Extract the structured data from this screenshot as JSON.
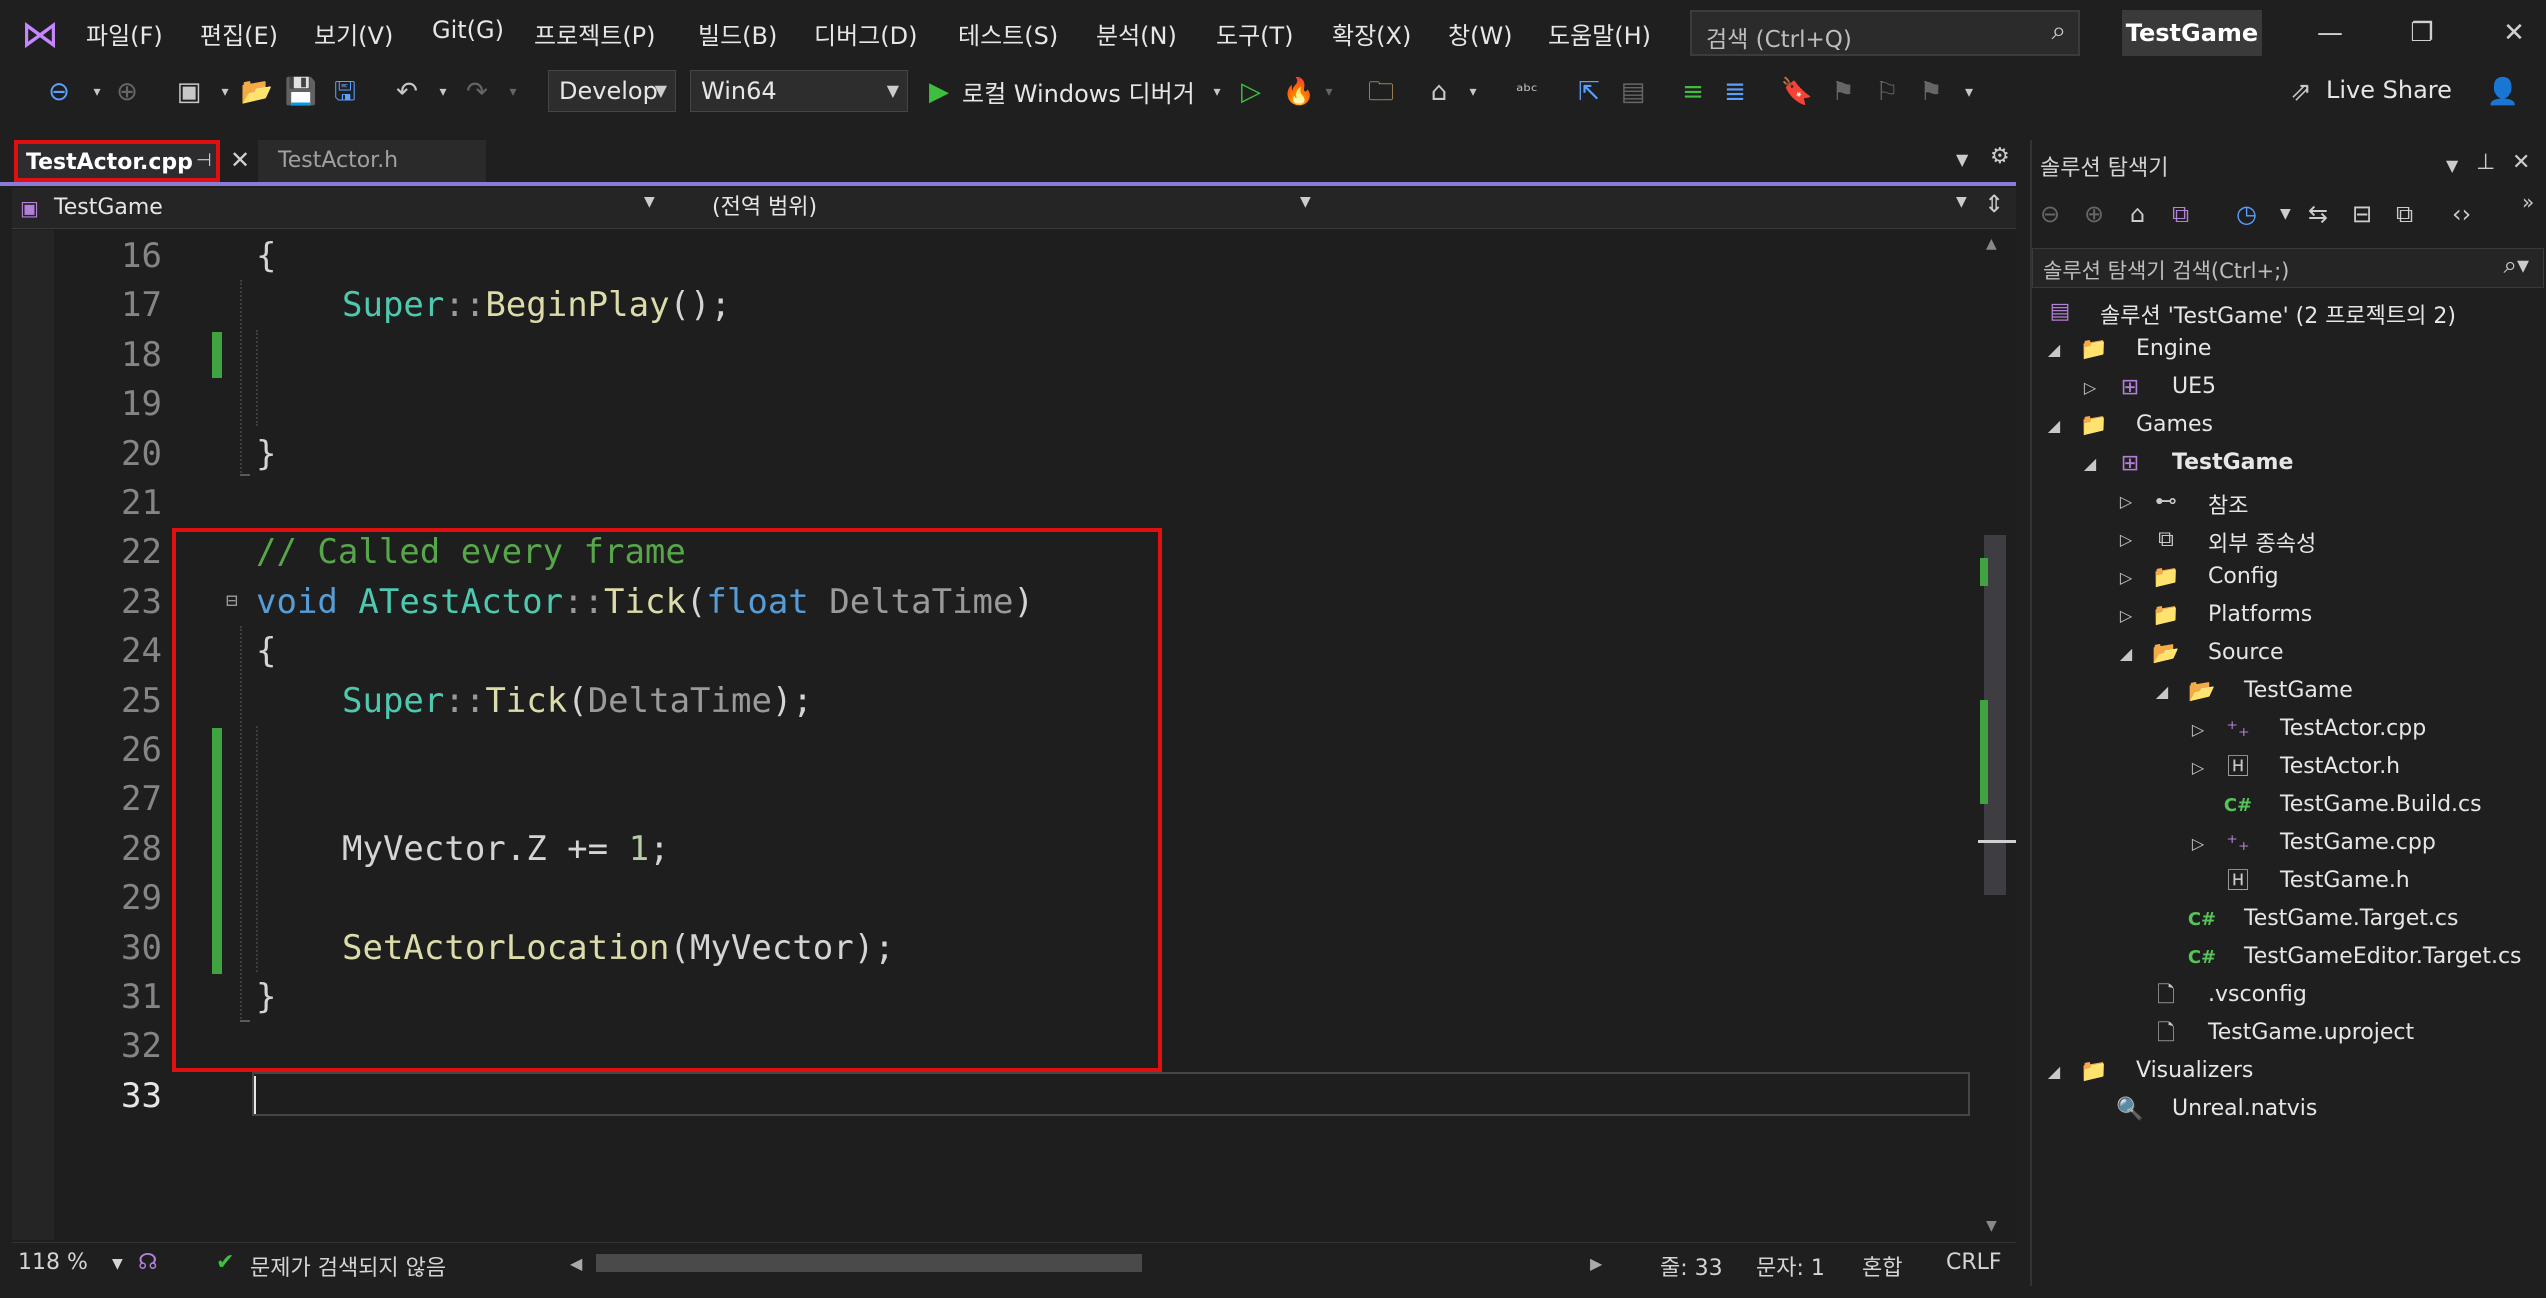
{
  "menu": {
    "items": [
      "파일(F)",
      "편집(E)",
      "보기(V)",
      "Git(G)",
      "프로젝트(P)",
      "빌드(B)",
      "디버그(D)",
      "테스트(S)",
      "분석(N)",
      "도구(T)",
      "확장(X)",
      "창(W)",
      "도움말(H)"
    ],
    "search_placeholder": "검색 (Ctrl+Q)",
    "solution_name": "TestGame"
  },
  "toolbar": {
    "config": "Develop",
    "platform": "Win64",
    "run_label": "로컬 Windows 디버거",
    "live_share": "Live Share"
  },
  "tabs": [
    {
      "label": "TestActor.cpp",
      "active": true
    },
    {
      "label": "TestActor.h",
      "active": false
    }
  ],
  "navbar": {
    "project": "TestGame",
    "scope": "(전역 범위)"
  },
  "editor": {
    "line_numbers": [
      "16",
      "17",
      "18",
      "19",
      "20",
      "21",
      "22",
      "23",
      "24",
      "25",
      "26",
      "27",
      "28",
      "29",
      "30",
      "31",
      "32",
      "33"
    ],
    "current_line": "33",
    "code": {
      "l16": "{",
      "l17_a": "Super",
      "l17_b": "::",
      "l17_c": "BeginPlay",
      "l17_d": "();",
      "l20": "}",
      "l22": "// Called every frame",
      "l23_a": "void",
      "l23_b": "ATestActor",
      "l23_c": "::",
      "l23_d": "Tick",
      "l23_e": "(",
      "l23_f": "float",
      "l23_g": "DeltaTime",
      "l23_h": ")",
      "l24": "{",
      "l25_a": "Super",
      "l25_b": "::",
      "l25_c": "Tick",
      "l25_d": "(",
      "l25_e": "DeltaTime",
      "l25_f": ");",
      "l28_a": "MyVector.Z += ",
      "l28_b": "1",
      "l28_c": ";",
      "l30_a": "SetActorLocation",
      "l30_b": "(MyVector);",
      "l31": "}"
    },
    "collapse_glyph": "⊟"
  },
  "status": {
    "zoom": "118 %",
    "issues": "문제가 검색되지 않음",
    "line": "줄: 33",
    "col": "문자: 1",
    "mixed": "혼합",
    "eol": "CRLF"
  },
  "solution_explorer": {
    "title": "솔루션 탐색기",
    "search_placeholder": "솔루션 탐색기 검색(Ctrl+;)",
    "tree": [
      {
        "label": "솔루션 'TestGame'  (2 프로젝트의 2)",
        "kind": "solution",
        "expander": "",
        "bold": false
      },
      {
        "label": "Engine",
        "kind": "folder",
        "expander": "◢",
        "bold": false
      },
      {
        "label": "UE5",
        "kind": "project",
        "expander": "▷",
        "bold": false
      },
      {
        "label": "Games",
        "kind": "folder",
        "expander": "◢",
        "bold": false
      },
      {
        "label": "TestGame",
        "kind": "project",
        "expander": "◢",
        "bold": true
      },
      {
        "label": "참조",
        "kind": "references",
        "expander": "▷",
        "bold": false
      },
      {
        "label": "외부 종속성",
        "kind": "external",
        "expander": "▷",
        "bold": false
      },
      {
        "label": "Config",
        "kind": "filter",
        "expander": "▷",
        "bold": false
      },
      {
        "label": "Platforms",
        "kind": "filter",
        "expander": "▷",
        "bold": false
      },
      {
        "label": "Source",
        "kind": "filter",
        "expander": "◢",
        "bold": false
      },
      {
        "label": "TestGame",
        "kind": "folder-filter",
        "expander": "◢",
        "bold": false
      },
      {
        "label": "TestActor.cpp",
        "kind": "cpp",
        "expander": "▷",
        "bold": false
      },
      {
        "label": "TestActor.h",
        "kind": "h",
        "expander": "▷",
        "bold": false
      },
      {
        "label": "TestGame.Build.cs",
        "kind": "cs",
        "expander": "",
        "bold": false
      },
      {
        "label": "TestGame.cpp",
        "kind": "cpp",
        "expander": "▷",
        "bold": false
      },
      {
        "label": "TestGame.h",
        "kind": "h",
        "expander": "",
        "bold": false
      },
      {
        "label": "TestGame.Target.cs",
        "kind": "cs",
        "expander": "",
        "bold": false
      },
      {
        "label": "TestGameEditor.Target.cs",
        "kind": "cs",
        "expander": "",
        "bold": false
      },
      {
        "label": ".vsconfig",
        "kind": "file",
        "expander": "",
        "bold": false
      },
      {
        "label": "TestGame.uproject",
        "kind": "file",
        "expander": "",
        "bold": false
      },
      {
        "label": "Visualizers",
        "kind": "folder",
        "expander": "◢",
        "bold": false
      },
      {
        "label": "Unreal.natvis",
        "kind": "natvis",
        "expander": "",
        "bold": false
      }
    ]
  }
}
